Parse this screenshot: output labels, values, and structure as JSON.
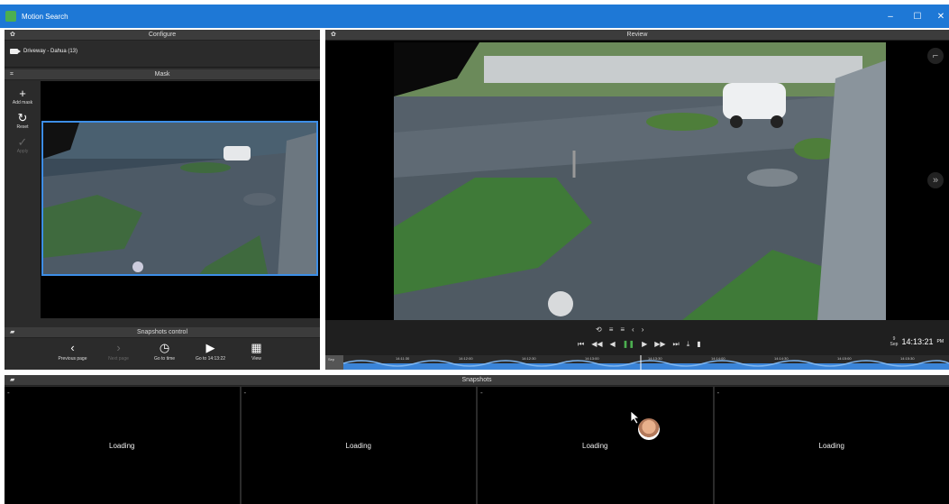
{
  "window": {
    "title": "Motion Search",
    "controls": [
      "–",
      "☐",
      "✕"
    ]
  },
  "configure": {
    "header": "Configure",
    "camera": "Driveway - Dahua (13)"
  },
  "mask": {
    "header": "Mask",
    "tools": [
      {
        "icon": "+",
        "label": "Add mask"
      },
      {
        "icon": "↻",
        "label": "Reset"
      },
      {
        "icon": "✓",
        "label": "Apply"
      }
    ]
  },
  "snapshots_control": {
    "header": "Snapshots control",
    "buttons": [
      {
        "icon": "‹",
        "label": "Previous page"
      },
      {
        "icon": "›",
        "label": "Next page"
      },
      {
        "icon": "◷",
        "label": "Go to time"
      },
      {
        "icon": "▶",
        "label": "Go to 14:13:22"
      },
      {
        "icon": "▦",
        "label": "View"
      }
    ]
  },
  "review": {
    "header": "Review",
    "time": "14:13:21",
    "date_day": "9",
    "date_month": "Sep",
    "ampm": "PM",
    "timeline_ticks": [
      "14:11:00",
      "14:11:30",
      "14:12:00",
      "14:12:30",
      "14:13:00",
      "14:13:30",
      "14:14:00",
      "14:14:30",
      "14:15:00",
      "14:15:30"
    ],
    "timeline_left": "Sep"
  },
  "snapshots": {
    "header": "Snapshots",
    "items": [
      "Loading",
      "Loading",
      "Loading",
      "Loading"
    ]
  }
}
